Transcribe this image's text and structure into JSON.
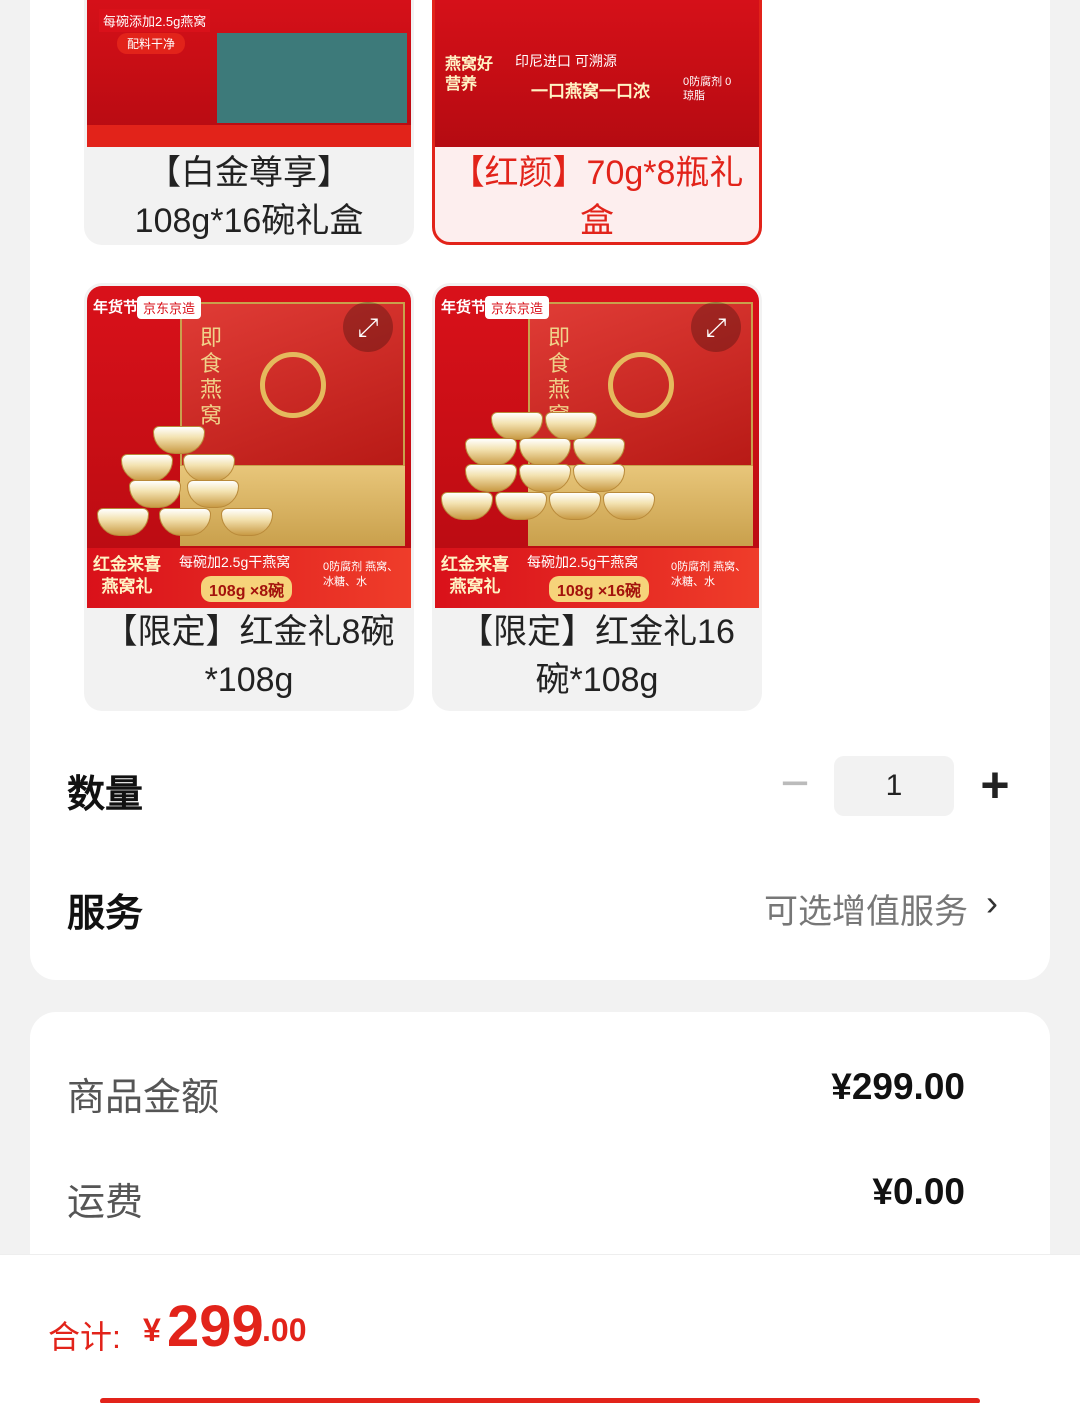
{
  "variants": [
    {
      "name": "【白金尊享】108g*16碗礼盒",
      "selected": false
    },
    {
      "name": "【红颜】70g*8瓶礼盒",
      "selected": true
    },
    {
      "name": "【限定】红金礼8碗*108g",
      "selected": false
    },
    {
      "name": "【限定】红金礼16碗*108g",
      "selected": false
    }
  ],
  "product_images": [
    {
      "top_text": "每碗添加2.5g燕窝",
      "tag": "配料干净"
    },
    {
      "top_text": "印尼进口 可溯源",
      "slogan": "一口燕窝一口浓",
      "side": "燕窝好营养",
      "note": "0防腐剂 0琼脂"
    },
    {
      "year_tag": "年货节",
      "jd_tag": "京东京造",
      "box_title": "即食燕窝",
      "banner_left": "红金来喜燕窝礼",
      "banner_mid": "每碗加2.5g干燕窝",
      "spec": "108g ×8碗",
      "banner_right": "0防腐剂 燕窝、冰糖、水"
    },
    {
      "year_tag": "年货节",
      "jd_tag": "京东京造",
      "box_title": "即食燕窝",
      "banner_left": "红金来喜燕窝礼",
      "banner_mid": "每碗加2.5g干燕窝",
      "spec": "108g ×16碗",
      "banner_right": "0防腐剂 燕窝、冰糖、水"
    }
  ],
  "quantity": {
    "label": "数量",
    "value": "1",
    "minus": "−",
    "plus": "+"
  },
  "service": {
    "label": "服务",
    "value": "可选增值服务",
    "chevron": "›"
  },
  "pricing": {
    "goods_label": "商品金额",
    "goods_value": "¥299.00",
    "shipping_label": "运费",
    "shipping_value": "¥0.00"
  },
  "total": {
    "label": "合计:",
    "yen": "¥",
    "int": "299",
    "dec": ".00"
  },
  "colors": {
    "accent": "#e2231a",
    "background": "#f2f2f2"
  }
}
